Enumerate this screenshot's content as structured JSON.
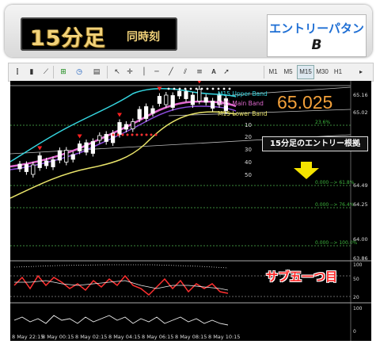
{
  "banner": {
    "title": "15分足",
    "subtitle": "同時刻",
    "entry_pattern_label": "エントリーパタン",
    "entry_pattern_value": "B"
  },
  "toolbar": {
    "timeframes": [
      "M1",
      "M5",
      "M15",
      "M30",
      "H1"
    ],
    "icons": [
      "chart-bars-icon",
      "chart-candles-icon",
      "chart-line-icon",
      "add-indicator-icon",
      "clock-icon",
      "templates-icon",
      "cursor-icon",
      "crosshair-icon",
      "vertical-line-icon",
      "horizontal-line-icon",
      "trendline-icon",
      "channel-icon",
      "fibonacci-icon",
      "text-tool-icon",
      "arrow-tool-icon"
    ]
  },
  "chart": {
    "current_price": "65.025",
    "bollinger_labels": [
      "M15 Upper Band",
      "M15 Main Band",
      "M15 Lower Band"
    ],
    "price_axis": [
      "65.16",
      "65.02",
      "64.49",
      "64.25",
      "64.00",
      "63.86"
    ],
    "fib_levels": [
      "0.000",
      "23.6%",
      "0.000 --> 61.8%",
      "0.000 --> 76.4%",
      "0.000 --> 100.0%"
    ],
    "left_scale": [
      "10",
      "20",
      "30",
      "40",
      "50"
    ],
    "basis_label": "15分足のエントリー根拠",
    "sub_window_label": "サブ五一つ目",
    "osc_scale_1": [
      "100",
      "50",
      "20"
    ],
    "osc_scale_2": [
      "100",
      "0"
    ],
    "time_axis": [
      "8 May 22:15",
      "8 May 00:15",
      "8 May 02:15",
      "8 May 04:15",
      "8 May 06:15",
      "8 May 08:15",
      "8 May 10:15"
    ],
    "colors": {
      "bg": "#000000",
      "upper": "#35d6e0",
      "main": "#e06ad0",
      "lower": "#e9e46a",
      "rsi": "#ff3030",
      "price": "#f2a03a"
    }
  }
}
